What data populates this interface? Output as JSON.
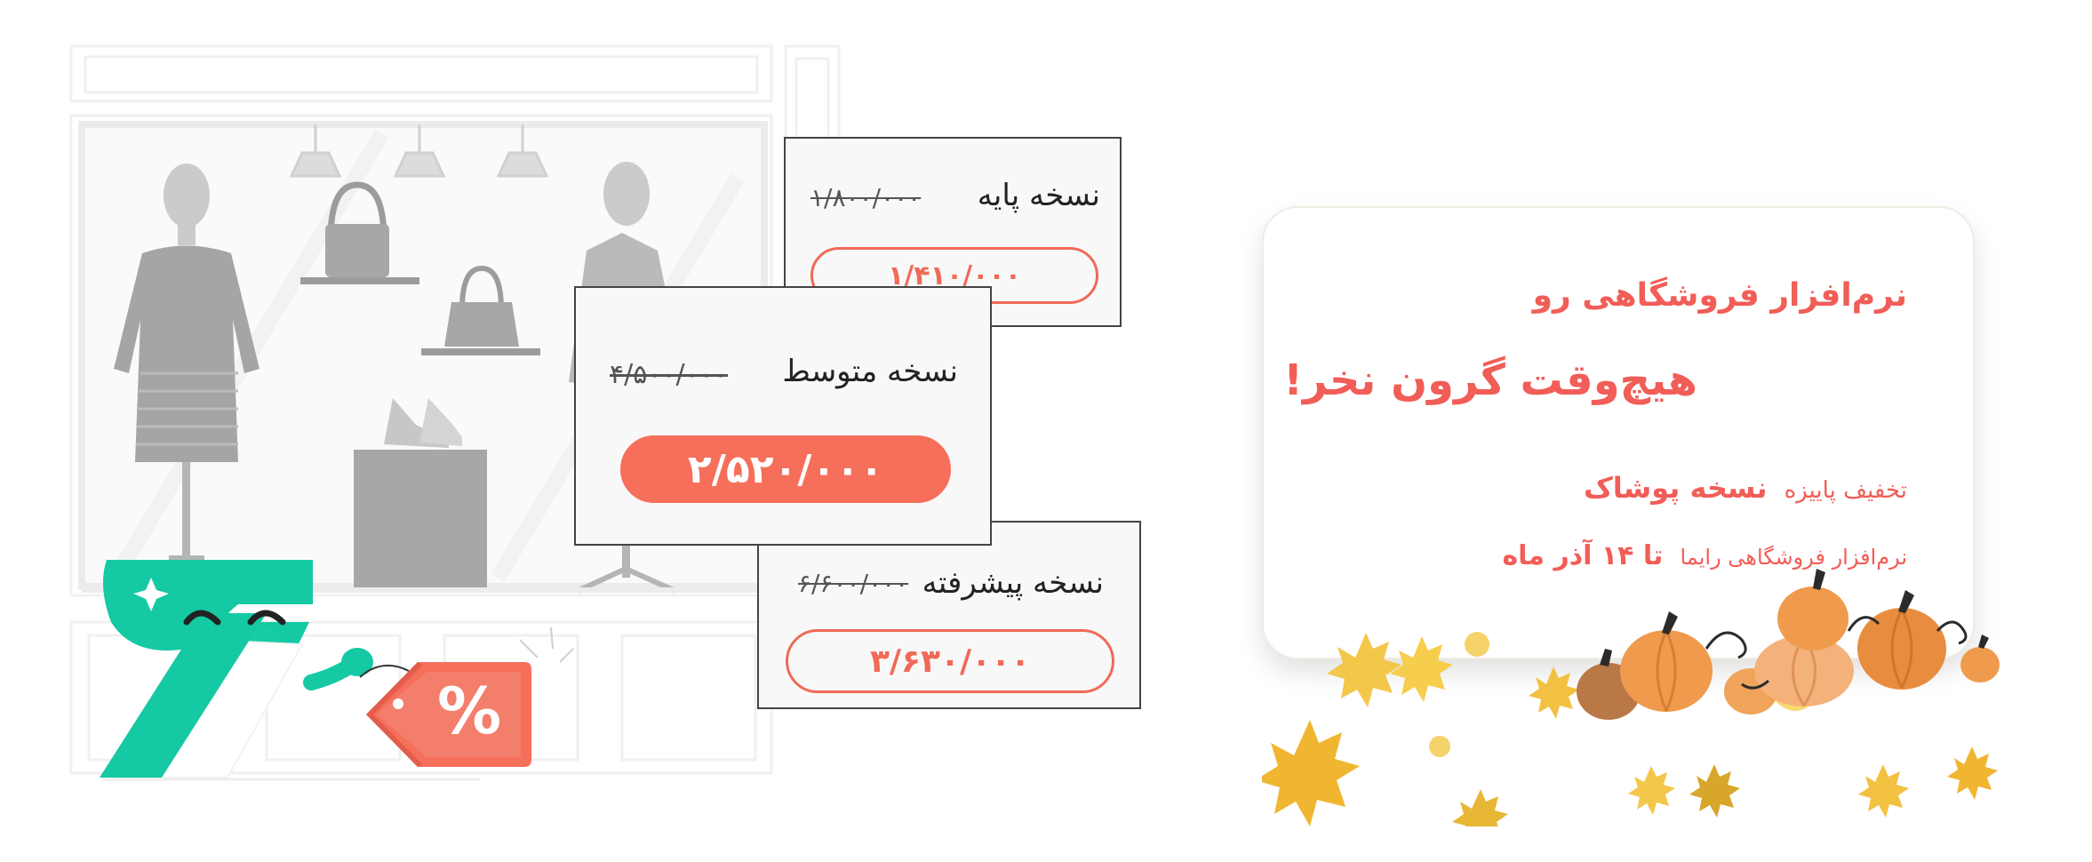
{
  "plans": [
    {
      "name": "نسخه پایه",
      "old_price": "۱/۸۰۰/۰۰۰",
      "price": "۱/۴۱۰/۰۰۰"
    },
    {
      "name": "نسخه متوسط",
      "old_price": "۴/۵۰۰/۰۰۰",
      "price": "۲/۵۲۰/۰۰۰"
    },
    {
      "name": "نسخه پیشرفته",
      "old_price": "۶/۶۰۰/۰۰۰",
      "price": "۳/۶۳۰/۰۰۰"
    }
  ],
  "promo": {
    "line1": "نرم‌افزار فروشگاهی رو",
    "line2": "هیچ‌وقت گرون نخر!",
    "line3_a": "تخفیف پاییزه",
    "line3_b": "نسخه پوشاک",
    "line4_a": "نرم‌افزار فروشگاهی رایما",
    "line4_b": "تا ۱۴ آذر ماه"
  },
  "tag": {
    "symbol": "%"
  },
  "colors": {
    "accent": "#f56f5b",
    "brand_green": "#12c9a2",
    "promo_text": "#f15d57"
  }
}
